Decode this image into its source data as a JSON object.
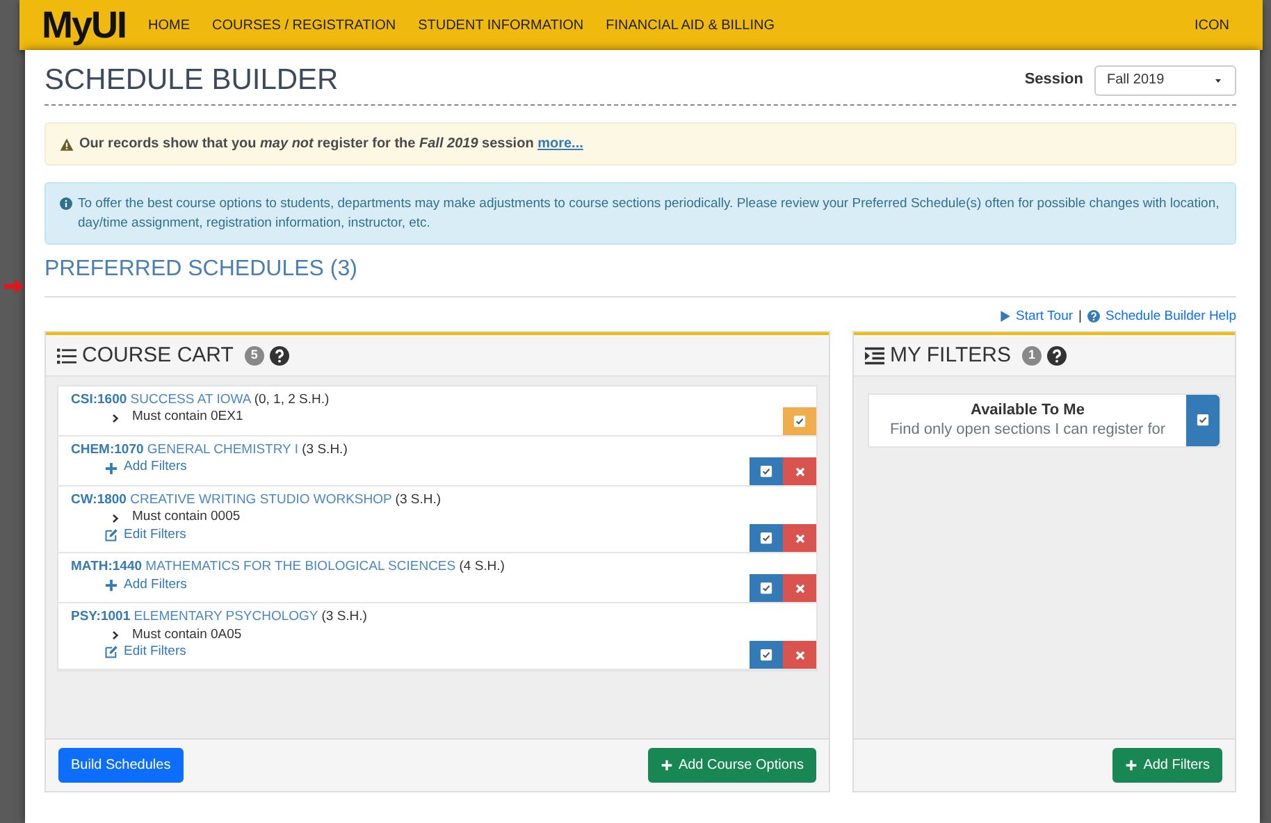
{
  "header": {
    "logo": "MyUI",
    "nav": [
      "HOME",
      "COURSES / REGISTRATION",
      "STUDENT INFORMATION",
      "FINANCIAL AID & BILLING"
    ],
    "right": "ICON"
  },
  "page": {
    "title": "SCHEDULE BUILDER",
    "session": {
      "label": "Session",
      "value": "Fall 2019"
    }
  },
  "warning": {
    "text": "Our records show that you *may not* register for the *Fall 2019* session",
    "link": "more..."
  },
  "info": "To offer the best course options to students, departments may make adjustments to course sections periodically. Please review your Preferred Schedule(s) often for possible changes with location, day/time assignment, registration information, instructor, etc.",
  "preferred": "PREFERRED SCHEDULES (3)",
  "help_links": [
    {
      "kind": "play",
      "label": "Start Tour"
    },
    {
      "kind": "help",
      "label": "Schedule Builder Help"
    }
  ],
  "help_separator": "|",
  "cart": {
    "title": "COURSE CART",
    "count": "5",
    "items": [
      {
        "code": "CSI:1600",
        "name": "SUCCESS AT IOWA",
        "credits": "(0, 1, 2 S.H.)",
        "detail": "Must contain 0EX1",
        "kind": "pending"
      },
      {
        "code": "CHEM:1070",
        "name": "GENERAL CHEMISTRY I",
        "credits": "(3 S.H.)",
        "link": {
          "kind": "add",
          "label": "Add Filters"
        },
        "kind": "normal"
      },
      {
        "code": "CW:1800",
        "name": "CREATIVE WRITING STUDIO WORKSHOP",
        "credits": "(3 S.H.)",
        "detail": "Must contain 0005",
        "link": {
          "kind": "edit",
          "label": "Edit Filters"
        },
        "kind": "normal"
      },
      {
        "code": "MATH:1440",
        "name": "MATHEMATICS FOR THE BIOLOGICAL SCIENCES",
        "credits": "(4 S.H.)",
        "link": {
          "kind": "add",
          "label": "Add Filters"
        },
        "kind": "normal"
      },
      {
        "code": "PSY:1001",
        "name": "ELEMENTARY PSYCHOLOGY",
        "credits": "(3 S.H.)",
        "detail": "Must contain 0A05",
        "link": {
          "kind": "edit",
          "label": "Edit Filters"
        },
        "kind": "normal"
      }
    ],
    "buttons": [
      {
        "label": "Build Schedules",
        "kind": "primary"
      },
      {
        "label": "Add Course Options",
        "kind": "add"
      }
    ]
  },
  "filters": {
    "title": "MY FILTERS",
    "count": "1",
    "items": [
      {
        "title": "Available To Me",
        "description": "Find only open sections I can register for",
        "checked": true
      }
    ],
    "button": "Add Filters"
  }
}
